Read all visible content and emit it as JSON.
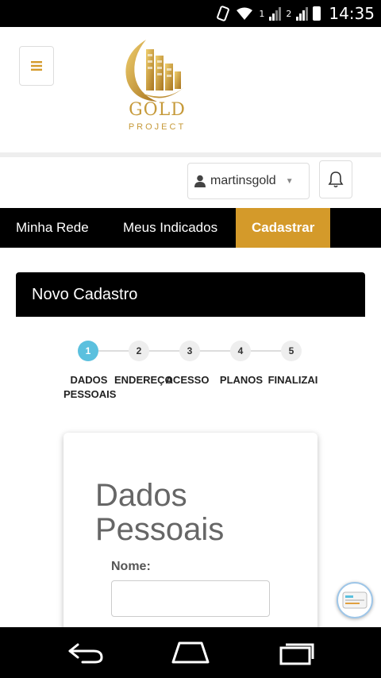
{
  "status_bar": {
    "sim1": "1",
    "sim2": "2",
    "time": "14:35"
  },
  "header": {
    "logo_gold": "GOLD",
    "logo_project": "PROJECT",
    "menu_icon": "hamburger-icon"
  },
  "user": {
    "username": "martinsgold",
    "user_icon": "user-icon",
    "bell_icon": "bell-icon"
  },
  "nav": {
    "items": [
      {
        "label": "Minha Rede"
      },
      {
        "label": "Meus Indicados"
      },
      {
        "label": "Cadastrar",
        "active": true
      }
    ]
  },
  "panel": {
    "title": "Novo Cadastro"
  },
  "stepper": {
    "steps": [
      {
        "number": "1",
        "label": "DADOS PESSOAIS",
        "active": true
      },
      {
        "number": "2",
        "label": "ENDEREÇO"
      },
      {
        "number": "3",
        "label": "ACESSO"
      },
      {
        "number": "4",
        "label": "PLANOS"
      },
      {
        "number": "5",
        "label": "FINALIZAI"
      }
    ]
  },
  "form": {
    "title_line1": "Dados",
    "title_line2": "Pessoais",
    "name_label": "Nome:",
    "name_value": ""
  },
  "colors": {
    "gold": "#d49a2a",
    "step_active": "#5bc0de",
    "black": "#000000"
  }
}
